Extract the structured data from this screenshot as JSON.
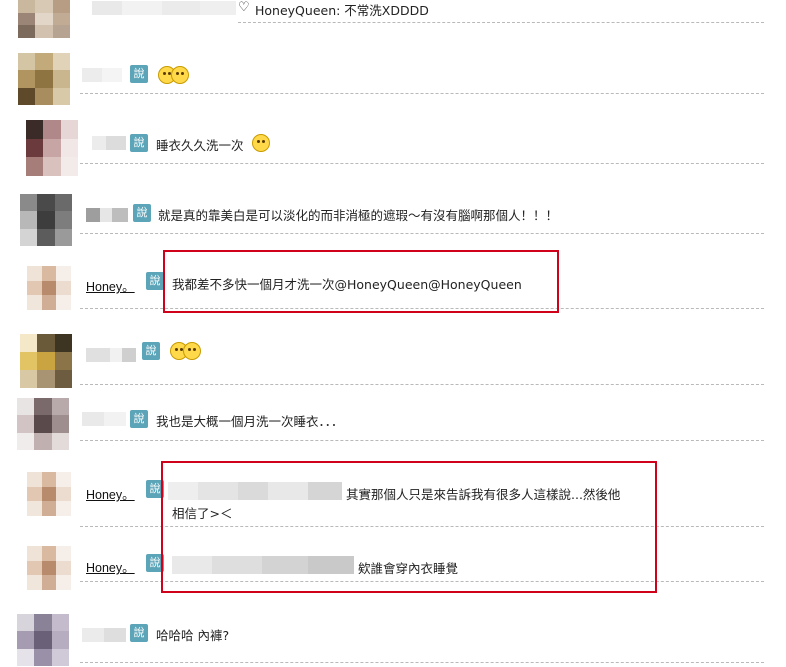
{
  "comments": [
    {
      "id": "c1",
      "text": "HoneyQueen: 不常洗XDDDD",
      "heart": "♡"
    },
    {
      "id": "c2",
      "says": "說",
      "text": ""
    },
    {
      "id": "c3",
      "says": "說",
      "text": "睡衣久久洗一次"
    },
    {
      "id": "c4",
      "says": "說",
      "text": "就是真的靠美白是可以淡化的而非消極的遮瑕～有沒有腦啊那個人！！！"
    },
    {
      "id": "c5",
      "name": "Honey。",
      "says": "說",
      "text": "我都差不多快一個月才洗一次@HoneyQueen@HoneyQueen"
    },
    {
      "id": "c6",
      "says": "說",
      "text": ""
    },
    {
      "id": "c7",
      "says": "說",
      "text": "我也是大概一個月洗一次睡衣．．．"
    },
    {
      "id": "c8",
      "name": "Honey。",
      "says": "說",
      "text": "其實那個人只是來告訴我有很多人這樣說...然後他",
      "text2": "相信了>＜"
    },
    {
      "id": "c9",
      "name": "Honey。",
      "says": "說",
      "text": "欸誰會穿內衣睡覺"
    },
    {
      "id": "c10",
      "says": "說",
      "text": "哈哈哈 內褲?"
    }
  ],
  "icons": {
    "smiley": "grin-emoticon-icon",
    "tongue": "tongue-emoticon-icon",
    "heart": "heart-icon"
  },
  "colors": {
    "highlight": "#d0021b",
    "says_badge": "#5ca4b8"
  }
}
